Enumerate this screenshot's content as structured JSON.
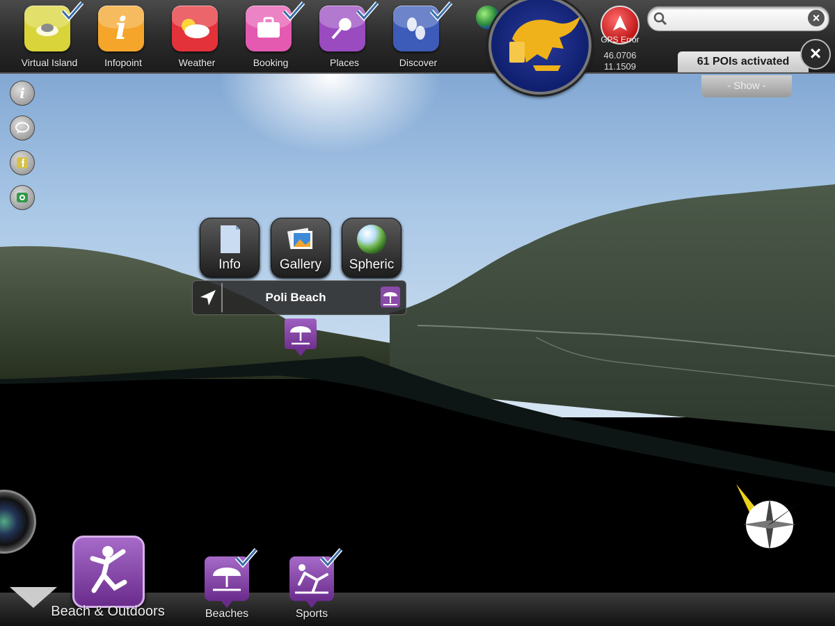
{
  "toolbar": {
    "apps": [
      {
        "label": "Virtual Island",
        "checked": true,
        "color": "#d9d43a"
      },
      {
        "label": "Infopoint",
        "checked": false,
        "color": "#f4a52a"
      },
      {
        "label": "Weather",
        "checked": false,
        "color": "#e4323a"
      },
      {
        "label": "Booking",
        "checked": true,
        "color": "#e45ab0"
      },
      {
        "label": "Places",
        "checked": true,
        "color": "#9a4bbf"
      },
      {
        "label": "Discover",
        "checked": true,
        "color": "#3d5bb8"
      }
    ],
    "gps": {
      "label": "GPS Error",
      "lat": "46.0706",
      "lon": "11.1509"
    },
    "search": {
      "value": "",
      "placeholder": ""
    }
  },
  "poi_panel": {
    "count_label": "61 POIs activated",
    "show_label": "- Show -"
  },
  "poi_actions": [
    {
      "label": "Info",
      "icon": "document-icon"
    },
    {
      "label": "Gallery",
      "icon": "photos-icon"
    },
    {
      "label": "Spheric",
      "icon": "sphere-icon"
    }
  ],
  "selected_poi": {
    "name": "Poli Beach",
    "icon": "beach-umbrella-icon"
  },
  "category": {
    "label": "Beach & Outdoors",
    "icon": "jumping-person-icon"
  },
  "subcategories": [
    {
      "label": "Beaches",
      "icon": "beach-umbrella-icon",
      "checked": true
    },
    {
      "label": "Sports",
      "icon": "sports-icon",
      "checked": true
    }
  ],
  "colors": {
    "accent": "#8a4aa8",
    "bar": "#2a2a2a"
  }
}
